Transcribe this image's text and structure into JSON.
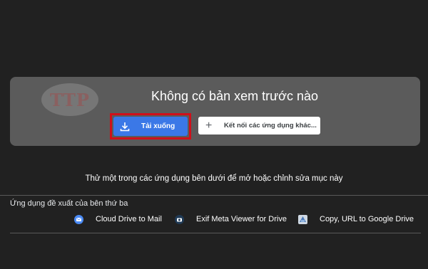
{
  "preview": {
    "watermark_text": "TTP",
    "title": "Không có bản xem trước nào",
    "download_label": "Tải xuống",
    "connect_label": "Kết nối các ứng dụng khác..."
  },
  "suggestion": {
    "try_text": "Thử một trong các ứng dụng bên dưới để mở hoặc chỉnh sửa mục này",
    "section_label": "Ứng dụng đề xuất của bên thứ ba"
  },
  "apps": [
    {
      "name": "Cloud Drive to Mail",
      "icon": "mail-cloud-icon",
      "color": "#4a8af4"
    },
    {
      "name": "Exif Meta Viewer for Drive",
      "icon": "camera-icon",
      "color": "#1f3a56"
    },
    {
      "name": "Copy, URL to Google Drive",
      "icon": "drive-copy-icon",
      "color": "#cfd8e3"
    }
  ],
  "colors": {
    "background": "#212121",
    "card": "#5b5b5b",
    "primary_button": "#3b78e7",
    "highlight_border": "#d0101a"
  }
}
